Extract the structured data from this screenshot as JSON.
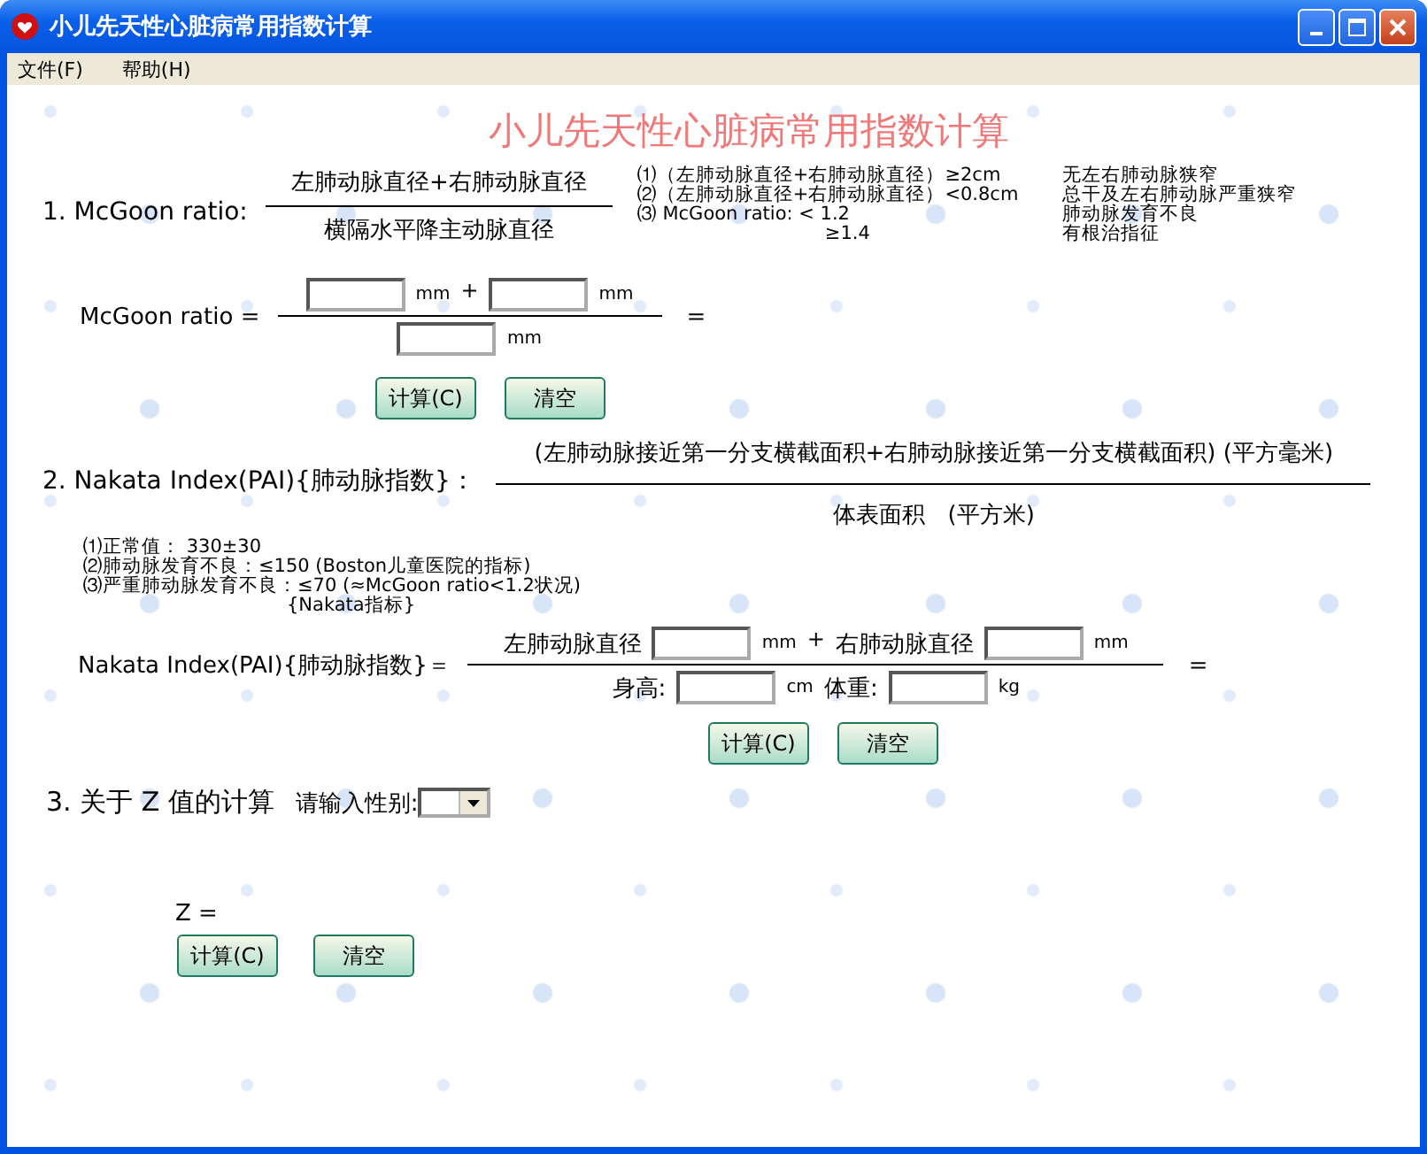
{
  "window": {
    "title": "小儿先天性心脏病常用指数计算"
  },
  "menu": [
    {
      "label": "文件(F)"
    },
    {
      "label": "帮助(H)"
    }
  ],
  "heading": "小儿先天性心脏病常用指数计算",
  "mcgoon": {
    "label": "1. McGoon ratio:",
    "numerator": "左肺动脉直径+右肺动脉直径",
    "denominator": "横隔水平降主动脉直径",
    "notes": [
      {
        "condition": "⑴（左肺动脉直径+右肺动脉直径）≥2cm",
        "meaning": "无左右肺动脉狭窄"
      },
      {
        "condition": "⑵（左肺动脉直径+右肺动脉直径）<0.8cm",
        "meaning": "总干及左右肺动脉严重狭窄"
      },
      {
        "condition": "⑶ McGoon ratio:  < 1.2",
        "meaning": "肺动脉发育不良"
      },
      {
        "condition": "≥1.4",
        "meaning": "有根治指征"
      }
    ],
    "formula": {
      "label": "McGoon ratio =",
      "numerator": [
        {
          "kind": "field"
        },
        {
          "kind": "unit",
          "text": "mm"
        },
        {
          "kind": "op",
          "text": "+"
        },
        {
          "kind": "field"
        },
        {
          "kind": "unit",
          "text": "mm"
        }
      ],
      "denominator": [
        {
          "kind": "field"
        },
        {
          "kind": "unit",
          "text": "mm"
        }
      ],
      "equals": "="
    },
    "buttons": [
      "计算(C)",
      "清空"
    ]
  },
  "nakata": {
    "label": "2. Nakata Index(PAI){肺动脉指数}：",
    "numerator": "(左肺动脉接近第一分支横截面积+右肺动脉接近第一分支横截面积) (平方毫米)",
    "denominator": "体表面积　(平方米)",
    "notes": [
      "⑴正常值： 330±30",
      "⑵肺动脉发育不良：≤150 (Boston儿童医院的指标)",
      "⑶严重肺动脉发育不良：≤70 (≈McGoon ratio<1.2状况)",
      "{Nakata指标}"
    ],
    "formula": {
      "label": "Nakata Index(PAI){肺动脉指数}＝",
      "numerator": [
        {
          "kind": "label",
          "text": "左肺动脉直径"
        },
        {
          "kind": "field"
        },
        {
          "kind": "unit",
          "text": "mm"
        },
        {
          "kind": "op",
          "text": "+"
        },
        {
          "kind": "label",
          "text": "右肺动脉直径"
        },
        {
          "kind": "field"
        },
        {
          "kind": "unit",
          "text": "mm"
        }
      ],
      "denominator": [
        {
          "kind": "label",
          "text": "身高:"
        },
        {
          "kind": "field"
        },
        {
          "kind": "unit",
          "text": "cm"
        },
        {
          "kind": "label",
          "text": "体重:"
        },
        {
          "kind": "field"
        },
        {
          "kind": "unit",
          "text": "kg"
        }
      ],
      "equals": "="
    },
    "buttons": [
      "计算(C)",
      "清空"
    ]
  },
  "zscore": {
    "label": "3. 关于 Z 值的计算",
    "sex_label": "请输入性别:",
    "result_label": "Z =",
    "buttons": [
      "计算(C)",
      "清空"
    ]
  }
}
